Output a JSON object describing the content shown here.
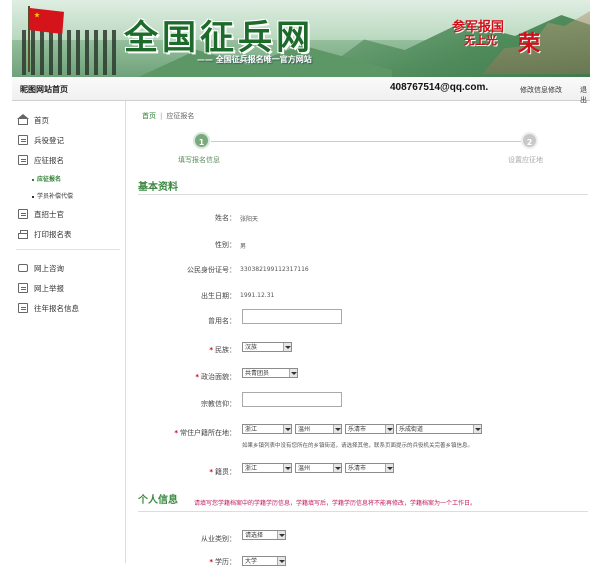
{
  "banner": {
    "title": "全国征兵网",
    "subtitle": "—— 全国征兵报名唯一官方网站",
    "slogan_1": "参军报国",
    "slogan_2": "无上光",
    "slogan_3": "荣"
  },
  "topbar": {
    "home": "昵图网站首页",
    "email": "408767514@qq.com.",
    "change_password": "修改信息修改",
    "logout": "退出"
  },
  "sidebar": {
    "items": [
      {
        "label": "首页",
        "icon": "home-icon"
      },
      {
        "label": "兵役登记",
        "icon": "register-icon"
      },
      {
        "label": "应征报名",
        "icon": "apply-icon"
      },
      {
        "label": "直招士官",
        "icon": "sergeant-icon"
      },
      {
        "label": "打印报名表",
        "icon": "print-icon"
      },
      {
        "label": "网上咨询",
        "icon": "chat-icon"
      },
      {
        "label": "网上举报",
        "icon": "report-icon"
      },
      {
        "label": "往年报名信息",
        "icon": "history-icon"
      }
    ],
    "subitems": [
      {
        "label": "应征报名"
      },
      {
        "label": "学员补偿代偿"
      }
    ]
  },
  "breadcrumb": {
    "home": "首页",
    "current": "应征报名"
  },
  "steps": [
    {
      "number": "1",
      "label": "填写报名信息"
    },
    {
      "number": "2",
      "label": "设置应征地"
    }
  ],
  "section_basic": "基本资料",
  "section_personal": "个人信息",
  "form": {
    "name_label": "姓名：",
    "name_value": "张阳天",
    "gender_label": "性别：",
    "gender_value": "男",
    "id_label": "公民身份证号：",
    "id_value": "330382199112317116",
    "birth_label": "出生日期：",
    "birth_value": "1991.12.31",
    "alias_label": "曾用名：",
    "ethnic_label": "民族：",
    "ethnic_value": "汉族",
    "political_label": "政治面貌：",
    "political_value": "共青团员",
    "religion_label": "宗教信仰：",
    "hukou_label": "常住户籍所在地：",
    "hukou_province": "浙江",
    "hukou_city": "温州",
    "hukou_county": "乐清市",
    "hukou_town": "乐成街道",
    "hukou_hint": "如果乡镇列表中没有您所在的乡镇街道，请选择其他，联系页面提示的兵役机关完善乡镇信息。",
    "native_label": "籍贯：",
    "native_province": "浙江",
    "native_city": "温州",
    "native_county": "乐清市",
    "personal_warn": "请填写您学籍档案中的学籍学历信息，学籍填写后，学籍学历信息将不能再修改，学籍档案为一个工作日。",
    "job_label": "从业类别：",
    "job_value": "请选择",
    "edu_label": "学历：",
    "edu_value": "大学"
  },
  "colors": {
    "accent": "#3d8a43",
    "required": "#d0021b",
    "warning": "#c2185b"
  }
}
